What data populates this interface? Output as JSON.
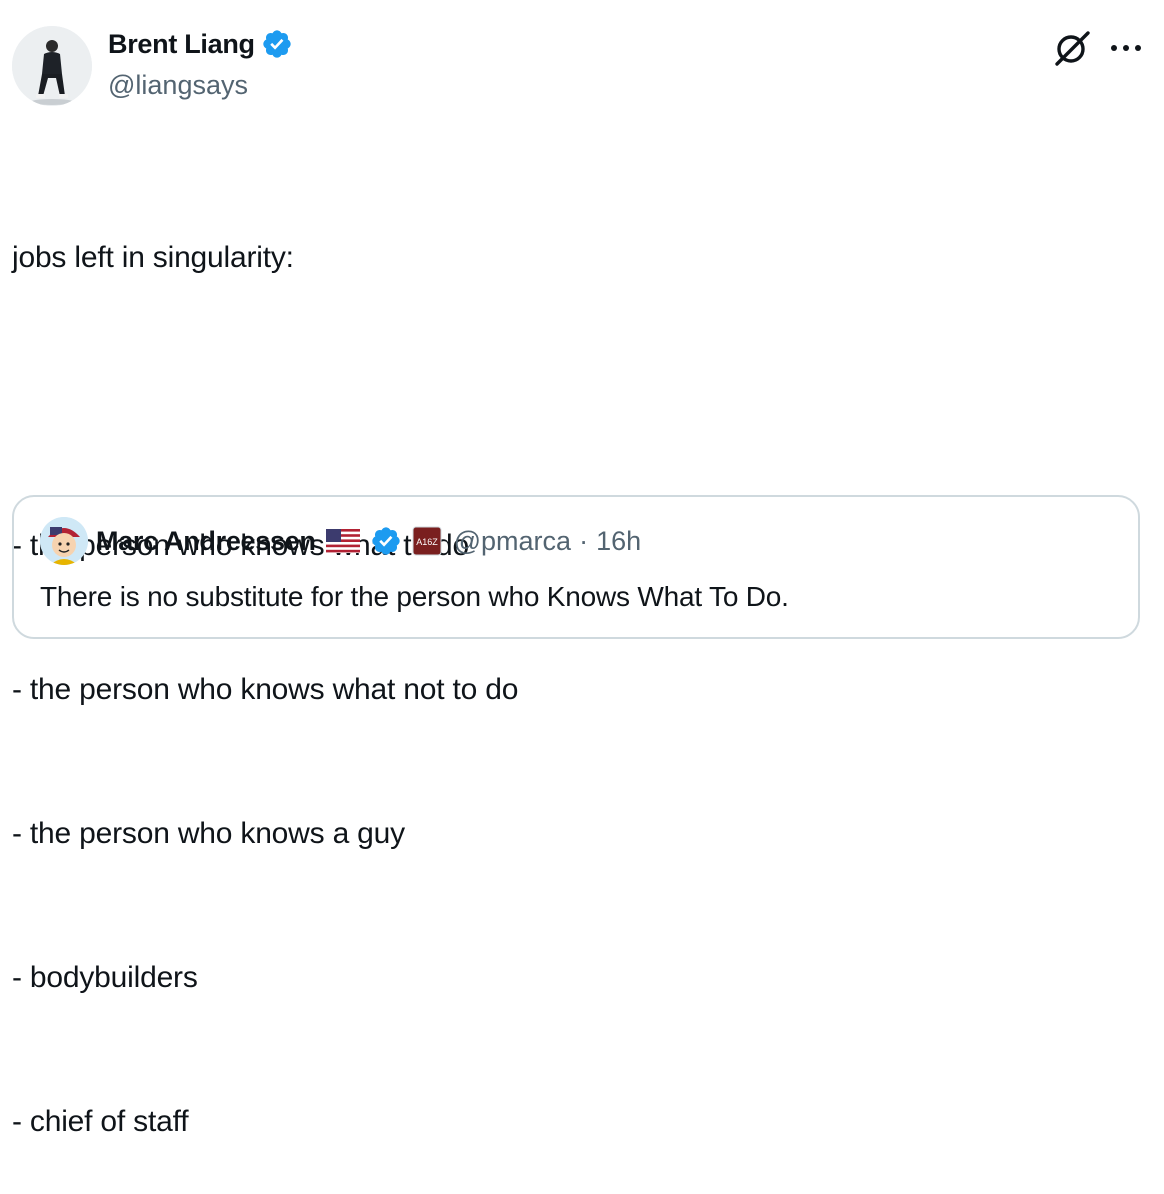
{
  "author": {
    "name": "Brent Liang",
    "handle": "@liangsays",
    "verified": true
  },
  "tweet": {
    "lines": [
      "jobs left in singularity:",
      "",
      "- the person who knows what to do",
      "- the person who knows what not to do",
      "- the person who knows a guy",
      "- bodybuilders",
      "- chief of staff"
    ]
  },
  "quoted_tweet": {
    "name": "Marc Andreessen",
    "handle": "@pmarca",
    "separator": "·",
    "time": "16h",
    "verified": true,
    "affiliate_label": "A16Z",
    "text": "There is no substitute for the person who Knows What To Do."
  },
  "icons": {
    "verified": "verified-badge-icon",
    "grok": "grok-icon",
    "more": "more-options-icon",
    "flag": "us-flag-icon",
    "affiliate": "a16z-affiliate-icon"
  },
  "colors": {
    "verified_blue": "#1d9bf0",
    "text_primary": "#0f1419",
    "text_secondary": "#536471",
    "border": "#cfd9de",
    "affiliate_bg": "#7a1f1f"
  }
}
